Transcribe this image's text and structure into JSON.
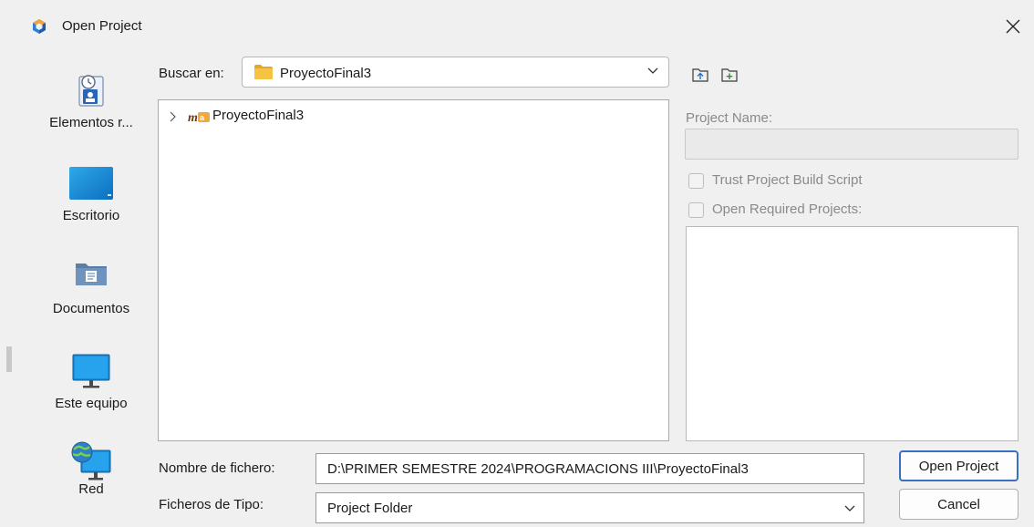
{
  "window": {
    "title": "Open Project",
    "close_glyph": "✕"
  },
  "places": [
    {
      "label": "Elementos r...",
      "icon": "recent-items-icon"
    },
    {
      "label": "Escritorio",
      "icon": "desktop-icon"
    },
    {
      "label": "Documentos",
      "icon": "documents-icon"
    },
    {
      "label": "Este equipo",
      "icon": "this-pc-icon"
    },
    {
      "label": "Red",
      "icon": "network-icon"
    }
  ],
  "look_in": {
    "label": "Buscar en:",
    "value": "ProyectoFinal3"
  },
  "file_list": {
    "items": [
      {
        "name": "ProyectoFinal3",
        "type": "maven-project",
        "expanded": false
      }
    ]
  },
  "project_panel": {
    "project_name_label": "Project Name:",
    "project_name_value": "",
    "trust_build_script_label": "Trust Project Build Script",
    "trust_build_script_checked": false,
    "open_required_label": "Open Required Projects:",
    "open_required_checked": false
  },
  "file_name": {
    "label": "Nombre de fichero:",
    "value": "D:\\PRIMER SEMESTRE 2024\\PROGRAMACIONS III\\ProyectoFinal3"
  },
  "file_type": {
    "label": "Ficheros de Tipo:",
    "value": "Project Folder"
  },
  "buttons": {
    "open": "Open Project",
    "cancel": "Cancel"
  },
  "colors": {
    "dialog_bg": "#f0f0f0",
    "accent_border": "#3b6fc2",
    "folder_yellow": "#f5c243",
    "disabled_text": "#8a8a8a"
  }
}
